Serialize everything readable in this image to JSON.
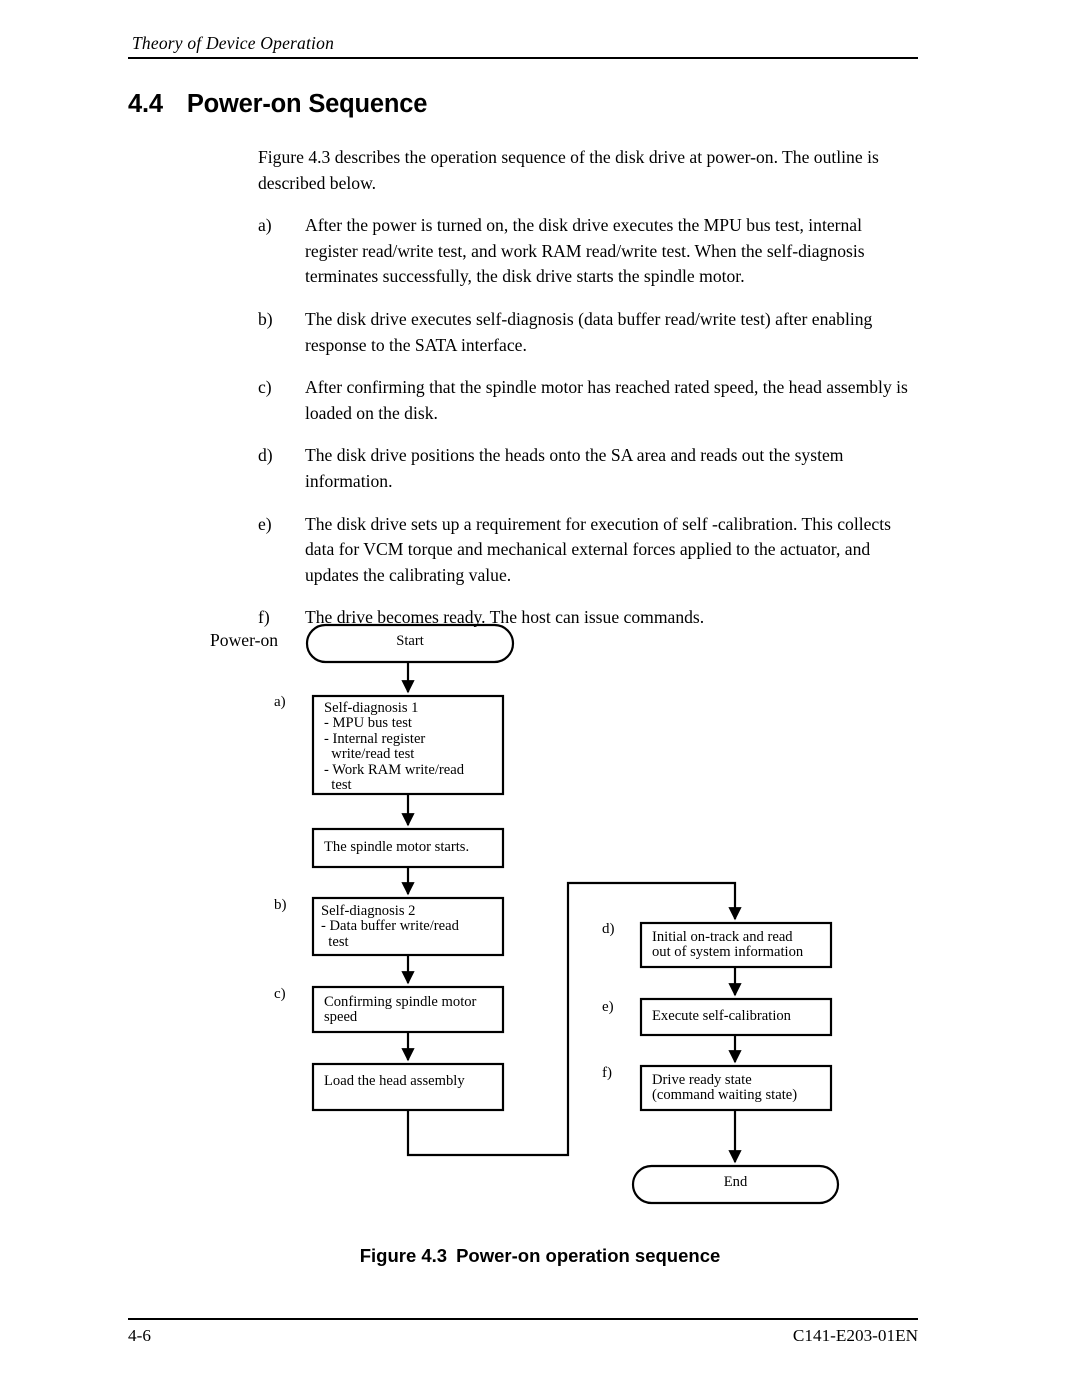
{
  "header": {
    "running_title": "Theory of Device Operation"
  },
  "section": {
    "number": "4.4",
    "title": "Power-on Sequence"
  },
  "body": {
    "intro": "Figure 4.3 describes the operation sequence of the disk drive at power-on.  The outline is described below.",
    "items": [
      {
        "marker": "a)",
        "text": "After the power is turned on, the disk drive executes the MPU bus test, internal register read/write test, and work RAM read/write test.  When the self-diagnosis terminates successfully, the disk drive starts the spindle motor."
      },
      {
        "marker": "b)",
        "text": "The disk drive executes self-diagnosis (data buffer read/write test) after enabling response to the SATA interface."
      },
      {
        "marker": "c)",
        "text": "After confirming that the spindle motor has reached rated speed, the head assembly is loaded on the disk."
      },
      {
        "marker": "d)",
        "text": "The disk drive positions the heads onto the SA area and reads out the system information."
      },
      {
        "marker": "e)",
        "text": "The disk drive sets up a requirement for execution of self -calibration.  This collects data for VCM torque and mechanical external forces applied to the actuator, and updates the calibrating value."
      },
      {
        "marker": "f)",
        "text": "The drive becomes ready.  The host can issue commands."
      }
    ]
  },
  "figure": {
    "power_on_label": "Power-on",
    "step_markers": {
      "a": "a)",
      "b": "b)",
      "c": "c)",
      "d": "d)",
      "e": "e)",
      "f": "f)"
    },
    "nodes": {
      "start": "Start",
      "self_diagnosis_1": "Self-diagnosis 1\n- MPU bus test\n- Internal register\n  write/read test\n- Work RAM write/read\n  test",
      "spindle_start": "The spindle motor starts.",
      "self_diagnosis_2": "Self-diagnosis 2\n- Data buffer write/read\n  test",
      "confirm_speed": "Confirming spindle motor\nspeed",
      "load_head": "Load the head assembly",
      "initial_ontrack": "Initial on-track and read\nout of system information",
      "self_calibration": "Execute self-calibration",
      "drive_ready": "Drive ready state\n(command waiting state)",
      "end": "End"
    },
    "caption_number": "Figure 4.3",
    "caption_title": "Power-on operation sequence"
  },
  "footer": {
    "page_number": "4-6",
    "document_number": "C141-E203-01EN"
  },
  "colors": {
    "ink": "#000000",
    "page": "#ffffff"
  }
}
